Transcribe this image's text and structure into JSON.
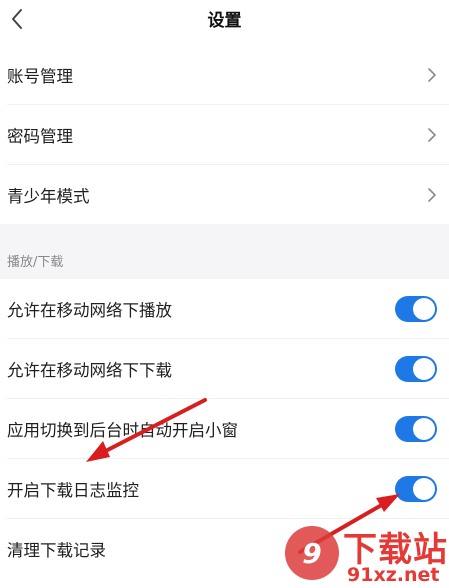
{
  "header": {
    "title": "设置"
  },
  "account_section": {
    "items": [
      {
        "label": "账号管理"
      },
      {
        "label": "密码管理"
      },
      {
        "label": "青少年模式"
      }
    ]
  },
  "playback_section": {
    "title": "播放/下载",
    "items": [
      {
        "label": "允许在移动网络下播放",
        "enabled": true
      },
      {
        "label": "允许在移动网络下下载",
        "enabled": true
      },
      {
        "label": "应用切换到后台时自动开启小窗",
        "enabled": true
      },
      {
        "label": "开启下载日志监控",
        "enabled": true
      }
    ],
    "clear_label": "清理下载记录"
  },
  "watermark": {
    "brand": "下载站",
    "url": "91xz.net",
    "badge": "9"
  },
  "colors": {
    "toggle_on": "#1e78e6",
    "arrow": "#d81e1e",
    "section_bg": "#f5f5f7"
  }
}
